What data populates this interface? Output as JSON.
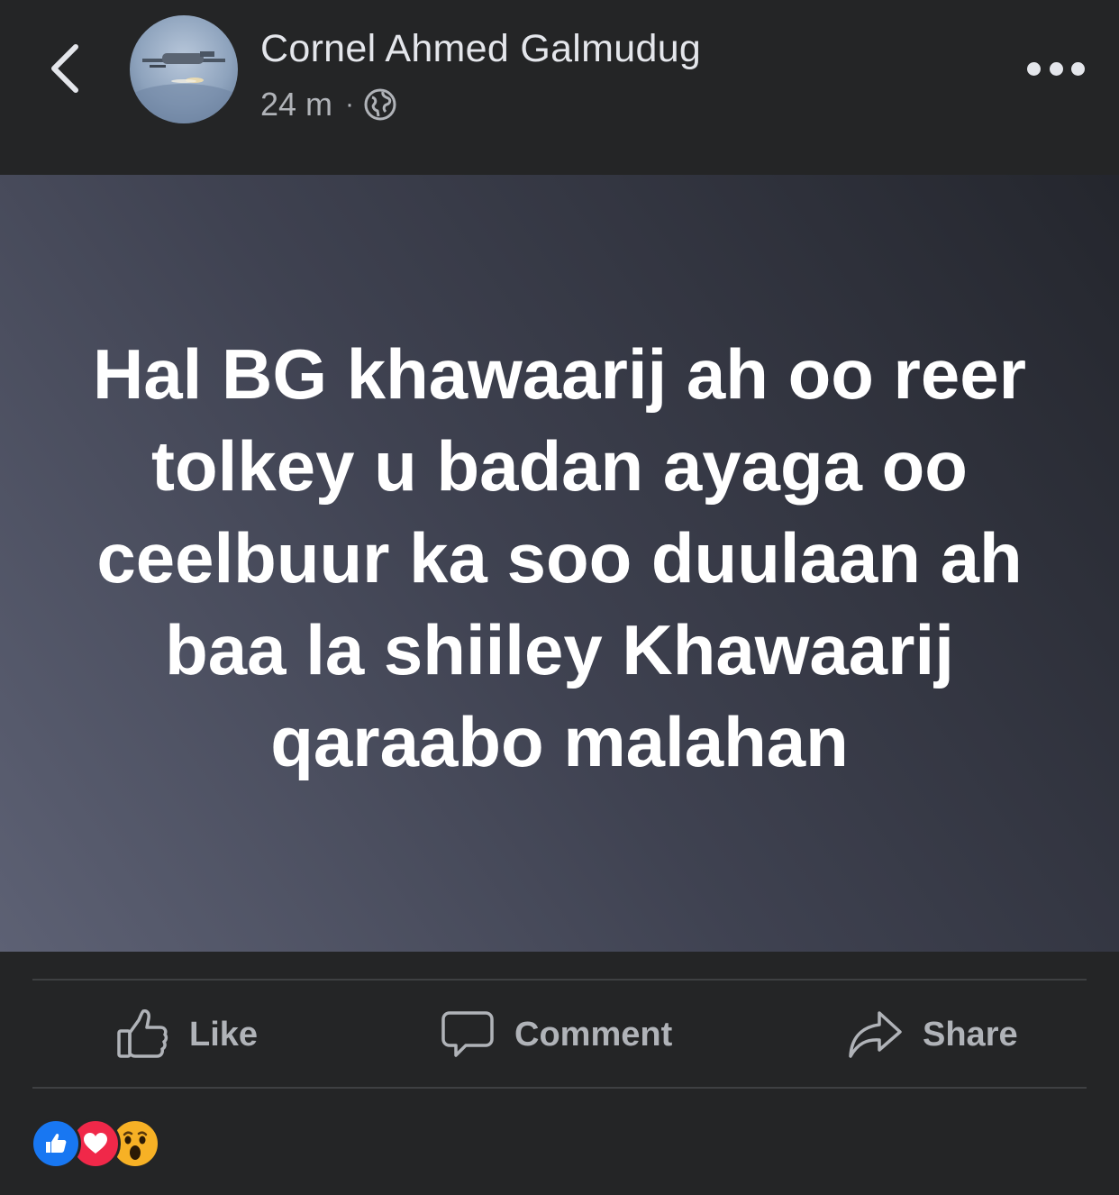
{
  "header": {
    "author_name": "Cornel Ahmed Galmudug",
    "timestamp": "24 m",
    "separator": "·",
    "privacy_icon": "globe-icon",
    "back_icon": "chevron-left-icon",
    "more_icon": "more-horizontal-icon"
  },
  "post": {
    "text": "Hal BG khawaarij ah oo reer tolkey u badan ayaga oo ceelbuur ka soo duulaan ah baa la shiiley Khawaarij qaraabo malahan",
    "background_colors": [
      "#5d6174",
      "#24262d"
    ]
  },
  "actions": {
    "like_label": "Like",
    "comment_label": "Comment",
    "share_label": "Share"
  },
  "reactions": {
    "items": [
      "like-reaction-icon",
      "love-reaction-icon",
      "wow-reaction-icon"
    ]
  },
  "colors": {
    "background": "#242526",
    "primary_text": "#e4e6eb",
    "secondary_text": "#b0b3b8",
    "like_blue": "#1877f2",
    "love_red": "#f02849",
    "wow_yellow": "#f7b125"
  }
}
